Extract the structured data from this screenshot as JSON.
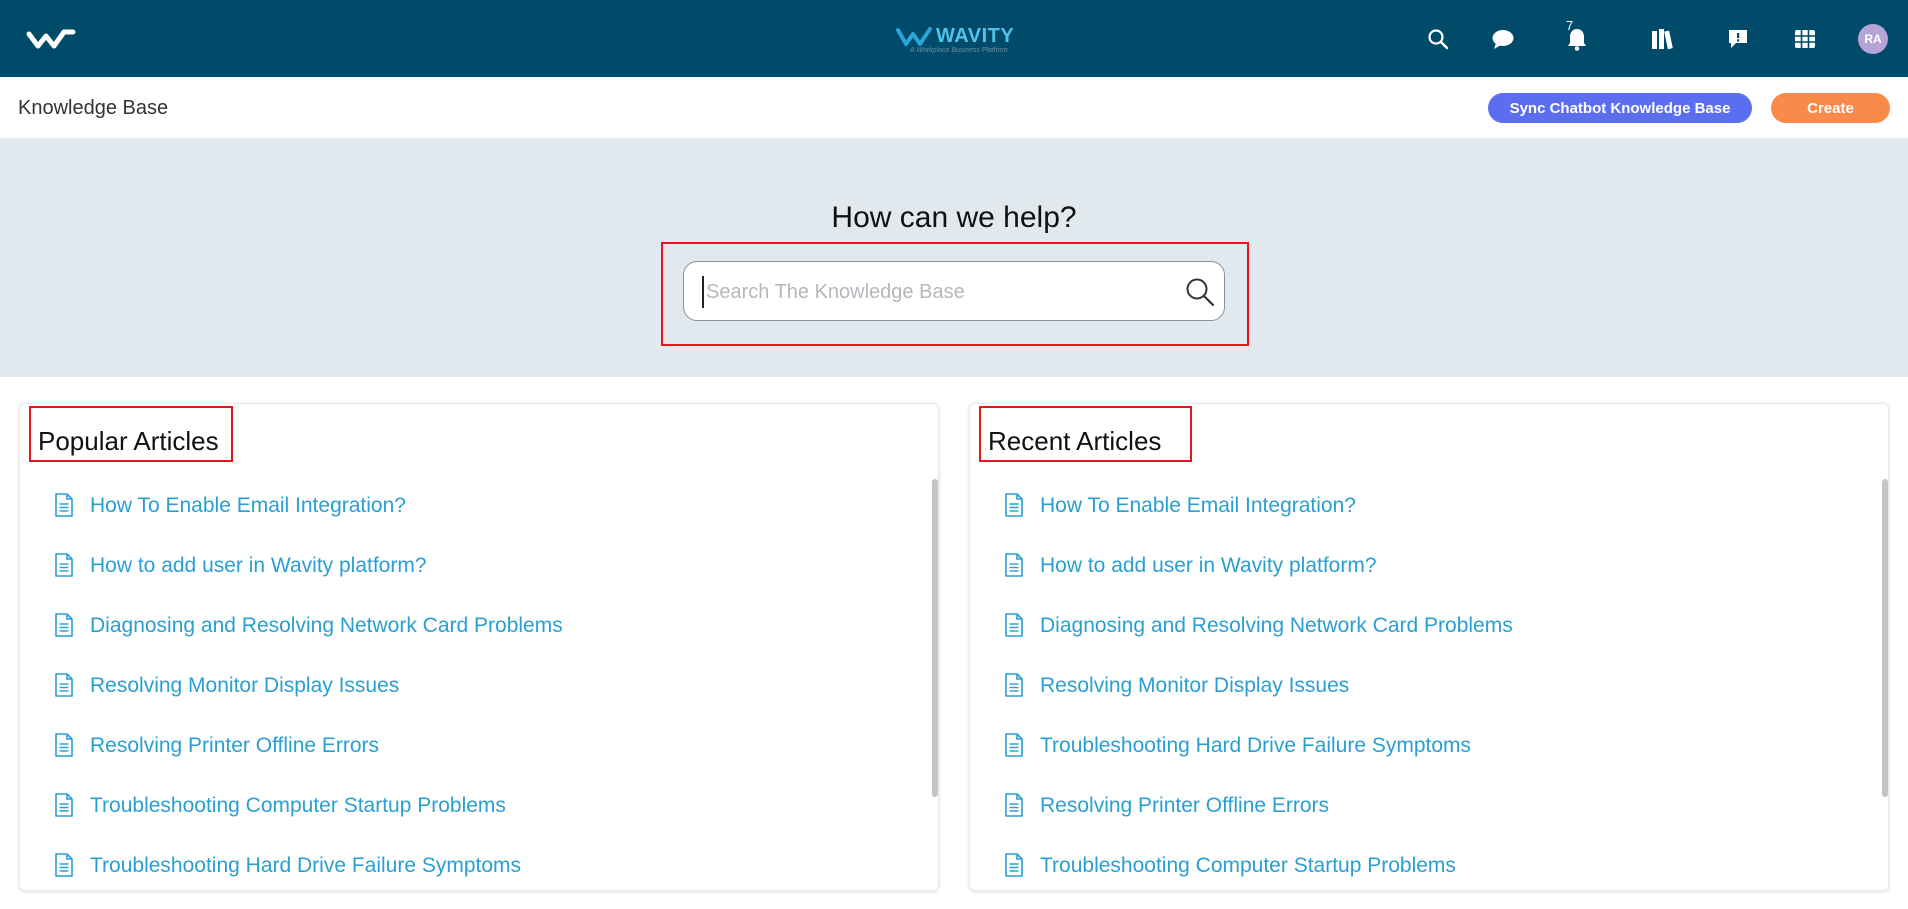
{
  "topbar": {
    "brand_name": "WAVITY",
    "brand_tagline": "A Workplace Business Platform",
    "notification_count": "7",
    "avatar_initials": "RA",
    "icons": [
      "app-logo-icon",
      "search-icon",
      "chat-icon",
      "bell-icon",
      "library-icon",
      "feedback-icon",
      "apps-grid-icon"
    ]
  },
  "subheader": {
    "title": "Knowledge Base",
    "sync_label": "Sync Chatbot Knowledge Base",
    "create_label": "Create"
  },
  "hero": {
    "title": "How can we help?",
    "search_placeholder": "Search The Knowledge Base",
    "search_value": ""
  },
  "popular": {
    "title": "Popular Articles",
    "items": [
      "How To Enable Email Integration?",
      "How to add user in Wavity platform?",
      "Diagnosing and Resolving Network Card Problems",
      "Resolving Monitor Display Issues",
      "Resolving Printer Offline Errors",
      "Troubleshooting Computer Startup Problems",
      "Troubleshooting Hard Drive Failure Symptoms"
    ]
  },
  "recent": {
    "title": "Recent Articles",
    "items": [
      "How To Enable Email Integration?",
      "How to add user in Wavity platform?",
      "Diagnosing and Resolving Network Card Problems",
      "Resolving Monitor Display Issues",
      "Troubleshooting Hard Drive Failure Symptoms",
      "Resolving Printer Offline Errors",
      "Troubleshooting Computer Startup Problems"
    ]
  },
  "colors": {
    "topbar": "#004a6a",
    "sync_button": "#5b6ef0",
    "create_button": "#f98a4a",
    "link": "#2a9fd1",
    "hero_bg": "#e1e9ee",
    "highlight": "#e8141b"
  }
}
